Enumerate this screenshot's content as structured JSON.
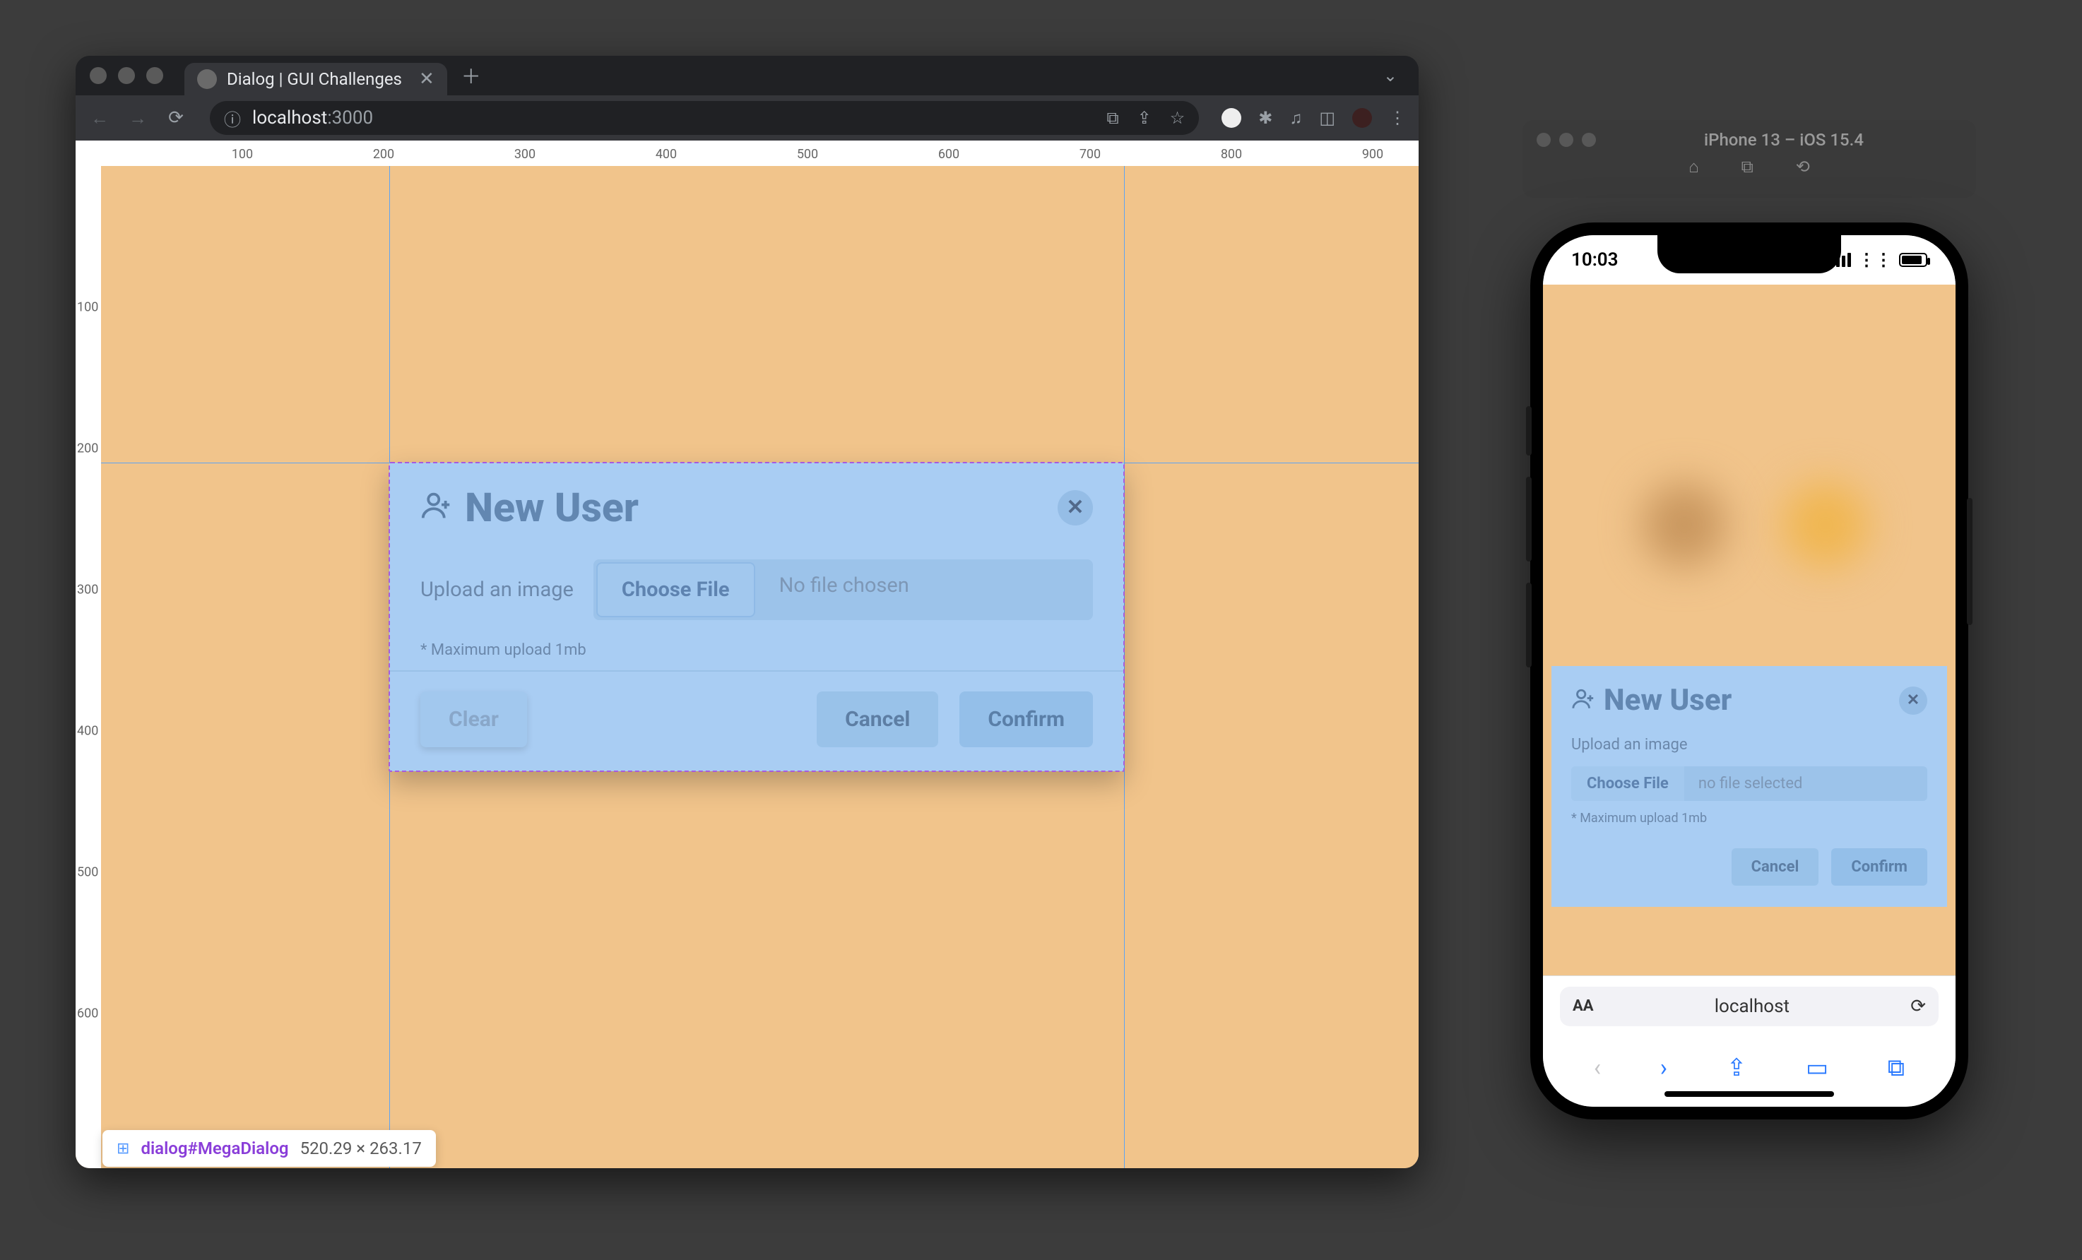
{
  "browser": {
    "tab_title": "Dialog | GUI Challenges",
    "url_host": "localhost",
    "url_port": ":3000"
  },
  "rulers": {
    "h": [
      "100",
      "200",
      "300",
      "400",
      "500",
      "600",
      "700",
      "800",
      "900"
    ],
    "v": [
      "100",
      "200",
      "300",
      "400",
      "500",
      "600"
    ]
  },
  "dialog": {
    "title": "New User",
    "upload_label": "Upload an image",
    "choose_file_label": "Choose File",
    "file_status": "No file chosen",
    "hint": "* Maximum upload 1mb",
    "clear_label": "Clear",
    "cancel_label": "Cancel",
    "confirm_label": "Confirm"
  },
  "devtools": {
    "selector_tag": "dialog",
    "selector_id": "#MegaDialog",
    "dims": "520.29 × 263.17"
  },
  "simulator": {
    "title": "iPhone 13 – iOS 15.4"
  },
  "iphone": {
    "time": "10:03",
    "safari_host": "localhost"
  },
  "mobile_dialog": {
    "title": "New User",
    "upload_label": "Upload an image",
    "choose_file_label": "Choose File",
    "file_status": "no file selected",
    "hint": "* Maximum upload 1mb",
    "cancel_label": "Cancel",
    "confirm_label": "Confirm"
  }
}
